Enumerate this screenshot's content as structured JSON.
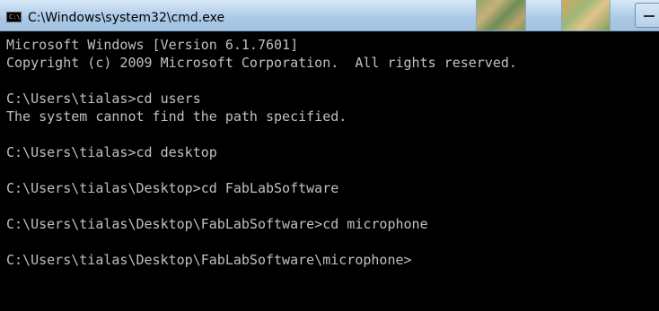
{
  "window": {
    "title": "C:\\Windows\\system32\\cmd.exe",
    "icon": "cmd-icon"
  },
  "console": {
    "lines": [
      "Microsoft Windows [Version 6.1.7601]",
      "Copyright (c) 2009 Microsoft Corporation.  All rights reserved.",
      "",
      "C:\\Users\\tialas>cd users",
      "The system cannot find the path specified.",
      "",
      "C:\\Users\\tialas>cd desktop",
      "",
      "C:\\Users\\tialas\\Desktop>cd FabLabSoftware",
      "",
      "C:\\Users\\tialas\\Desktop\\FabLabSoftware>cd microphone",
      "",
      "C:\\Users\\tialas\\Desktop\\FabLabSoftware\\microphone>"
    ]
  },
  "colors": {
    "console_bg": "#000000",
    "console_text": "#c0c0c0",
    "titlebar": "#b9d3ec"
  }
}
